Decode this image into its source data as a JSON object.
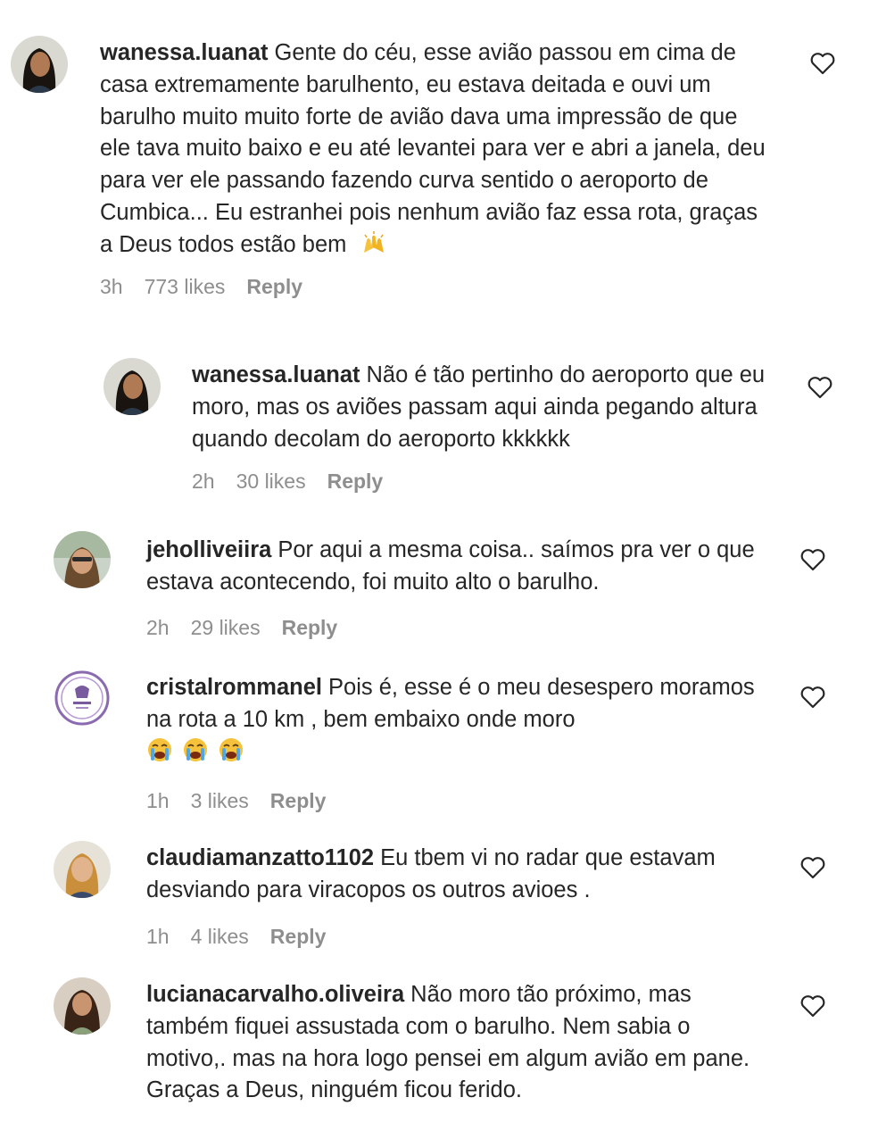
{
  "comments": [
    {
      "username": "wanessa.luanat",
      "text": "Gente do céu, esse avião passou em cima de casa extremamente barulhento, eu estava deitada e ouvi um barulho muito muito forte de avião dava uma impressão de que ele tava muito baixo e eu até levantei para ver e abri a janela, deu para ver ele passando fazendo curva sentido o aeroporto de Cumbica... Eu estranhei pois nenhum avião faz essa rota, graças a Deus todos estão bem",
      "emoji": "raising-hands",
      "time": "3h",
      "likes": "773 likes",
      "reply": "Reply"
    },
    {
      "username": "wanessa.luanat",
      "text": "Não é tão pertinho do aeroporto que eu moro, mas os aviões passam aqui ainda pegando altura quando decolam do aeroporto kkkkkk",
      "time": "2h",
      "likes": "30 likes",
      "reply": "Reply"
    },
    {
      "username": "jeholliveiira",
      "text": "Por aqui a mesma coisa.. saímos pra ver o que estava acontecendo, foi muito alto o barulho.",
      "time": "2h",
      "likes": "29 likes",
      "reply": "Reply"
    },
    {
      "username": "cristalrommanel",
      "text": "Pois é, esse é o meu desespero moramos na rota a 10 km , bem embaixo onde moro",
      "emoji": "loudly-crying-face x3",
      "time": "1h",
      "likes": "3 likes",
      "reply": "Reply"
    },
    {
      "username": "claudiamanzatto1102",
      "text": "Eu tbem vi no radar que estavam desviando para viracopos os outros avioes .",
      "time": "1h",
      "likes": "4 likes",
      "reply": "Reply"
    },
    {
      "username": "lucianacarvalho.oliveira",
      "text": "Não moro tão próximo, mas também fiquei assustada com o barulho. Nem sabia o motivo,. mas na hora logo pensei em algum avião em pane. Graças a Deus, ninguém ficou ferido."
    }
  ],
  "icons": {
    "like": "heart-outline-icon",
    "avatar": "avatar-photo"
  },
  "colors": {
    "text": "#262626",
    "meta": "#8e8e8e",
    "background": "#ffffff"
  }
}
